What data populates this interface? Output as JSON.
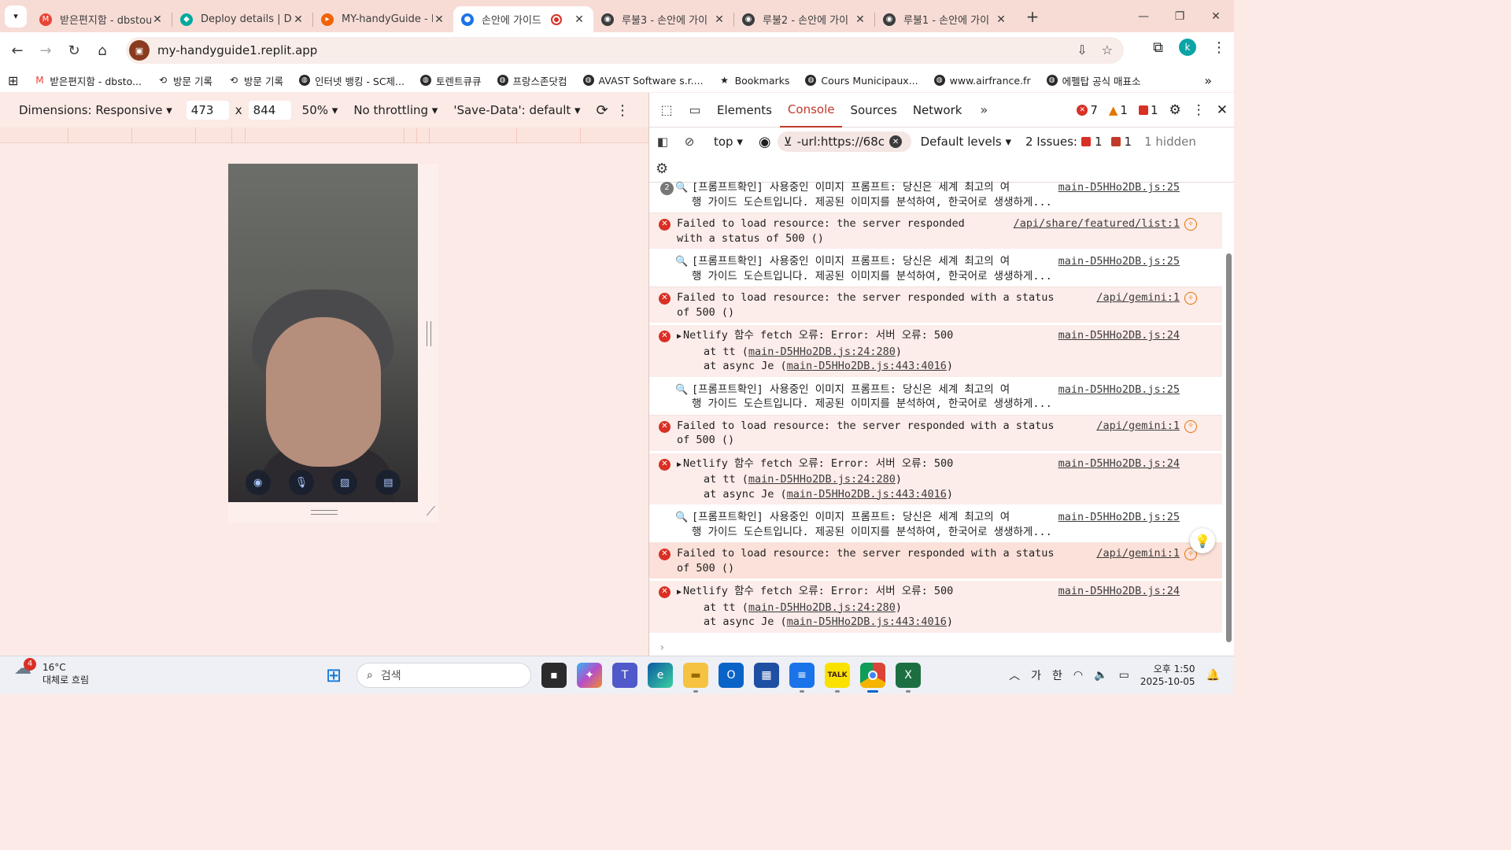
{
  "tabs": [
    {
      "title": "받은편지함 - dbstou",
      "fav_color": "#ea4335",
      "fav_glyph": "M",
      "active": false,
      "recording": false
    },
    {
      "title": "Deploy details | Dep",
      "fav_color": "#00a99d",
      "fav_glyph": "◆",
      "active": false,
      "recording": false
    },
    {
      "title": "MY-handyGuide - Re",
      "fav_color": "#f26207",
      "fav_glyph": "▸",
      "active": false,
      "recording": false
    },
    {
      "title": "손안에 가이드",
      "fav_color": "#1a73e8",
      "fav_glyph": "●",
      "active": true,
      "recording": true
    },
    {
      "title": "루불3 - 손안에 가이",
      "fav_color": "#3c3c3c",
      "fav_glyph": "◉",
      "active": false,
      "recording": false
    },
    {
      "title": "루불2 - 손안에 가이",
      "fav_color": "#3c3c3c",
      "fav_glyph": "◉",
      "active": false,
      "recording": false
    },
    {
      "title": "루불1 - 손안에 가이",
      "fav_color": "#3c3c3c",
      "fav_glyph": "◉",
      "active": false,
      "recording": false
    }
  ],
  "address": {
    "url": "my-handyguide1.replit.app"
  },
  "profile_initial": "k",
  "bookmarks": [
    {
      "label": "받은편지함 - dbsto...",
      "icon": "gmail-icon"
    },
    {
      "label": "방문 기록",
      "icon": "history-icon"
    },
    {
      "label": "방문 기록",
      "icon": "history-icon"
    },
    {
      "label": "인터넷 뱅킹 - SC제...",
      "icon": "globe-icon"
    },
    {
      "label": "토렌트큐큐",
      "icon": "globe-icon"
    },
    {
      "label": "프랑스존닷컴",
      "icon": "globe-icon"
    },
    {
      "label": "AVAST Software s.r....",
      "icon": "globe-icon"
    },
    {
      "label": "Bookmarks",
      "icon": "star-icon"
    },
    {
      "label": "Cours Municipaux...",
      "icon": "globe-icon"
    },
    {
      "label": "www.airfrance.fr",
      "icon": "globe-icon"
    },
    {
      "label": "에펠탑 공식 매표소",
      "icon": "globe-icon"
    }
  ],
  "device_toolbar": {
    "dimensions": "Dimensions: Responsive",
    "width": "473",
    "height": "844",
    "times": "x",
    "zoom": "50%",
    "throttling": "No throttling",
    "save_data": "'Save-Data': default"
  },
  "devtools": {
    "tabs": [
      "Elements",
      "Console",
      "Sources",
      "Network"
    ],
    "active_tab": "Console",
    "error_count": "7",
    "warning_count": "1",
    "issue_count": "1",
    "context": "top",
    "filter": "-url:https://68c",
    "levels": "Default levels",
    "issues_label": "2 Issues:",
    "issues_err": "1",
    "issues_info": "1",
    "hidden": "1 hidden"
  },
  "console": {
    "prompt_badge": "2",
    "prompt_text": "[프롬프트확인] 사용중인 이미지 프롬프트: 당신은 세계 최고의 여\n행 가이드 도슨트입니다. 제공된 이미지를 분석하여, 한국어로 생생하게...",
    "prompt_src": "main-D5HHo2DB.js:25",
    "fail_featured": "Failed to load resource: the server responded\nwith a status of 500 ()",
    "fail_featured_src": "/api/share/featured/list:1",
    "fail_gemini": "Failed to load resource: the server responded with a status\nof 500 ()",
    "fail_gemini_src": "/api/gemini:1",
    "netlify_text": "Netlify 함수 fetch 오류: Error: 서버 오류: 500",
    "netlify_src": "main-D5HHo2DB.js:24",
    "stack1_pre": "at tt (",
    "stack1_link": "main-D5HHo2DB.js:24:280",
    "stack1_post": ")",
    "stack2_pre": "at async Je (",
    "stack2_link": "main-D5HHo2DB.js:443:4016",
    "stack2_post": ")",
    "input_prompt": "›"
  },
  "taskbar": {
    "weather_temp": "16°C",
    "weather_desc": "대체로 흐림",
    "weather_badge": "4",
    "search_placeholder": "검색",
    "ime_a": "가",
    "ime_b": "한",
    "time": "오후 1:50",
    "date": "2025-10-05"
  }
}
